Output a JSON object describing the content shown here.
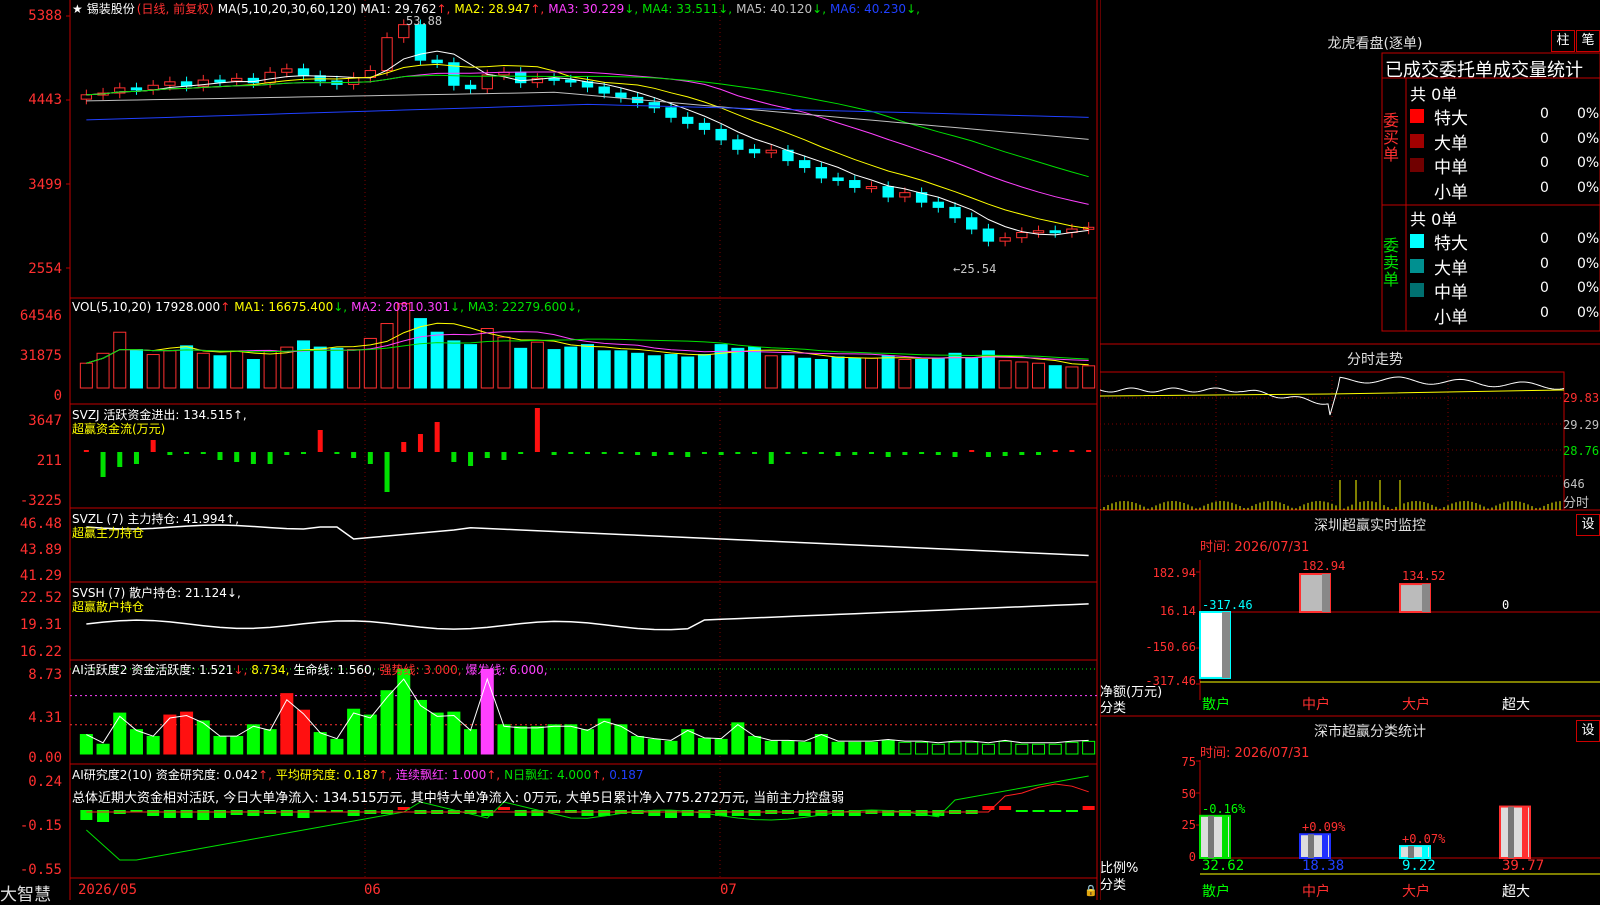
{
  "main_header": {
    "star": "★",
    "stock_name": "锡装股份",
    "mode": "(日线, 前复权)",
    "ma_def": "MA(5,10,20,30,60,120)",
    "ma": [
      {
        "label": "MA1:",
        "value": "29.762",
        "arrow": "↑",
        "color": "#ffffff"
      },
      {
        "label": "MA2:",
        "value": "28.947",
        "arrow": "↑",
        "color": "#ffff00"
      },
      {
        "label": "MA3:",
        "value": "30.229",
        "arrow": "↓",
        "color": "#ff40ff"
      },
      {
        "label": "MA4:",
        "value": "33.511",
        "arrow": "↓",
        "color": "#00e000"
      },
      {
        "label": "MA5:",
        "value": "40.120",
        "arrow": "↓",
        "color": "#c0c0c0"
      },
      {
        "label": "MA6:",
        "value": "40.230",
        "arrow": "↓",
        "color": "#2040ff"
      }
    ],
    "high_marker": "53.88",
    "low_marker": "←25.54"
  },
  "price_axis": [
    "5388",
    "4443",
    "3499",
    "2554"
  ],
  "vol_header": {
    "def": "VOL(5,10,20)",
    "value": "17928.000",
    "arrow": "↑",
    "ma": [
      {
        "label": "MA1:",
        "value": "16675.400",
        "arrow": "↓",
        "color": "#ffff00"
      },
      {
        "label": "MA2:",
        "value": "20810.301",
        "arrow": "↓",
        "color": "#ff40ff"
      },
      {
        "label": "MA3:",
        "value": "22279.600",
        "arrow": "↓",
        "color": "#00e000"
      }
    ]
  },
  "vol_axis": [
    "64546",
    "31875",
    "0"
  ],
  "svzj": {
    "line1": "SVZJ  活跃资金进出: 134.515↑,",
    "line2": "超赢资金流(万元)",
    "axis": [
      "3647",
      "211",
      "-3225"
    ]
  },
  "svzl": {
    "line1": "SVZL (7) 主力持仓: 41.994↑,",
    "line2": "超赢主力持仓",
    "axis": [
      "46.48",
      "43.89",
      "41.29"
    ]
  },
  "svsh": {
    "line1": "SVSH (7) 散户持仓: 21.124↓,",
    "line2": "超赢散户持仓",
    "axis": [
      "22.52",
      "19.31",
      "16.22"
    ]
  },
  "ai1": {
    "title": "AI活跃度2 资金活跃度: 1.521",
    "v2": "8.734,",
    "v3": "生命线: 1.560,",
    "v4": "强势线: 3.000,",
    "v5": "爆发线: 6.000,",
    "axis": [
      "8.73",
      "4.31",
      "0.00"
    ]
  },
  "ai2": {
    "title": "AI研究度2(10) 资金研究度: 0.042",
    "v2": "平均研究度: 0.187",
    "v3": "连续飘红: 1.000",
    "v4": "N日飘红: 4.000",
    "v5": "0.187",
    "summary": "总体近期大资金相对活跃, 今日大单净流入: 134.515万元, 其中特大单净流入: 0万元, 大单5日累计净入775.272万元, 当前主力控盘弱",
    "axis": [
      "0.24",
      "-0.15",
      "-0.55"
    ]
  },
  "date_axis": [
    "2026/05",
    "06",
    "07"
  ],
  "brand": "大智慧",
  "right": {
    "lhb_title": "龙虎看盘(逐单)",
    "btn_col": "柱",
    "btn_pen": "笔",
    "tabs": "已成交委托单成交量统计",
    "buy_side_label": "委买单",
    "sell_side_label": "委卖单",
    "buy_total": "共 0单",
    "sell_total": "共 0单",
    "buy_rows": [
      {
        "name": "特大",
        "n": "0",
        "pct": "0%",
        "color": "#ff0000"
      },
      {
        "name": "大单",
        "n": "0",
        "pct": "0%",
        "color": "#a00000"
      },
      {
        "name": "中单",
        "n": "0",
        "pct": "0%",
        "color": "#700000"
      },
      {
        "name": "小单",
        "n": "0",
        "pct": "0%",
        "color": "#000000"
      }
    ],
    "sell_rows": [
      {
        "name": "特大",
        "n": "0",
        "pct": "0%",
        "color": "#00ffff"
      },
      {
        "name": "大单",
        "n": "0",
        "pct": "0%",
        "color": "#009090"
      },
      {
        "name": "中单",
        "n": "0",
        "pct": "0%",
        "color": "#007070"
      },
      {
        "name": "小单",
        "n": "0",
        "pct": "0%",
        "color": "#000000"
      }
    ],
    "minute_title": "分时走势",
    "minute_axis": [
      "29.83",
      "29.29",
      "28.76",
      "646"
    ],
    "minute_unit": "分时",
    "monitor_title": "深圳超赢实时监控",
    "monitor_btn": "设",
    "monitor_time": "时间: 2026/07/31",
    "monitor_axis": [
      "182.94",
      "16.14",
      "-150.66",
      "-317.46"
    ],
    "monitor_ylabel1": "净额(万元)",
    "monitor_ylabel2": "分类",
    "monitor_values": [
      "-317.46",
      "182.94",
      "134.52",
      "0"
    ],
    "monitor_cats": [
      "散户",
      "中户",
      "大户",
      "超大"
    ],
    "classify_title": "深市超赢分类统计",
    "classify_btn": "设",
    "classify_time": "时间: 2026/07/31",
    "classify_axis": [
      "75",
      "50",
      "25",
      "0"
    ],
    "classify_ylabel1": "比例%",
    "classify_ylabel2": "分类",
    "classify_changes": [
      "-0.16%",
      "+0.09%",
      "+0.07%",
      ""
    ],
    "classify_values": [
      "32.62",
      "18.38",
      "9.22",
      "39.77"
    ],
    "classify_cats": [
      "散户",
      "中户",
      "大户",
      "超大"
    ]
  },
  "chart_data": {
    "type": "candlestick",
    "n": 61,
    "ohlc_scale": "price",
    "close": [
      45.2,
      45.4,
      46.0,
      45.8,
      46.3,
      46.7,
      46.2,
      46.9,
      46.8,
      47.1,
      46.6,
      47.8,
      48.2,
      47.4,
      46.8,
      46.4,
      47.2,
      48.0,
      51.8,
      53.3,
      49.2,
      48.9,
      46.3,
      45.9,
      47.5,
      47.8,
      46.6,
      47.1,
      46.9,
      46.7,
      46.1,
      45.4,
      44.9,
      44.3,
      43.7,
      42.6,
      41.9,
      41.2,
      40.0,
      38.9,
      38.5,
      38.8,
      37.6,
      36.8,
      35.6,
      35.3,
      34.5,
      34.6,
      33.4,
      33.9,
      32.8,
      32.2,
      31.0,
      29.7,
      28.3,
      28.7,
      29.3,
      29.5,
      29.3,
      29.7,
      29.9
    ],
    "volume": [
      20000,
      28000,
      45000,
      31000,
      27000,
      30000,
      34000,
      28000,
      26000,
      30000,
      23000,
      30000,
      33000,
      38000,
      33000,
      32000,
      31000,
      40000,
      52000,
      68000,
      56000,
      45000,
      38000,
      35000,
      48000,
      41000,
      32000,
      37000,
      31000,
      33000,
      35000,
      30000,
      30000,
      28000,
      26000,
      27000,
      25000,
      27000,
      35000,
      32000,
      33000,
      26000,
      26000,
      24000,
      23000,
      25000,
      24000,
      24000,
      26000,
      23000,
      23000,
      24000,
      28000,
      24000,
      30000,
      22000,
      21000,
      20000,
      18000,
      17000,
      17900
    ]
  }
}
